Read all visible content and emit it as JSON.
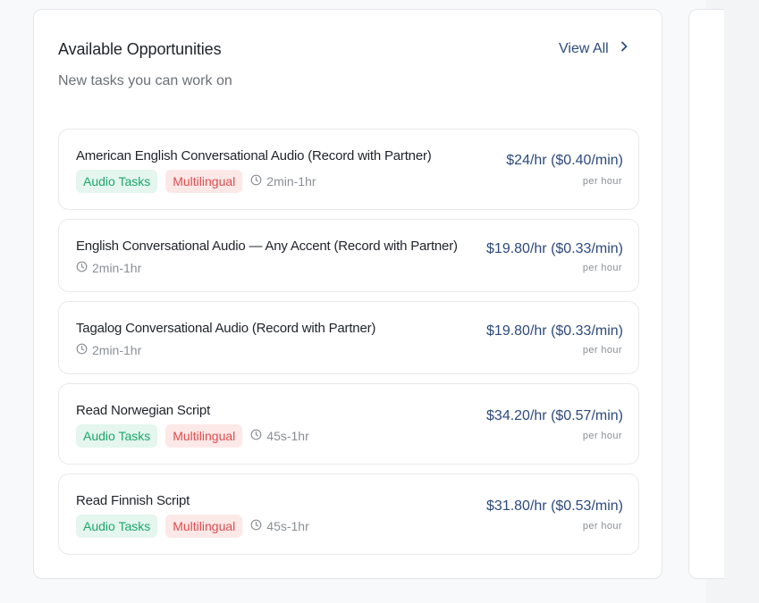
{
  "panel": {
    "title": "Available Opportunities",
    "subtitle": "New tasks you can work on",
    "view_all_label": "View All",
    "view_all_icon": "chevron-right-icon"
  },
  "tasks": [
    {
      "title": "American English Conversational Audio (Record with Partner)",
      "tags": [
        "Audio Tasks",
        "Multilingual"
      ],
      "duration": "2min-1hr",
      "rate": "$24/hr ($0.40/min)",
      "rate_unit": "per hour"
    },
    {
      "title": "English Conversational Audio — Any Accent (Record with Partner)",
      "tags": [],
      "duration": "2min-1hr",
      "rate": "$19.80/hr ($0.33/min)",
      "rate_unit": "per hour"
    },
    {
      "title": "Tagalog Conversational Audio (Record with Partner)",
      "tags": [],
      "duration": "2min-1hr",
      "rate": "$19.80/hr ($0.33/min)",
      "rate_unit": "per hour"
    },
    {
      "title": "Read Norwegian Script",
      "tags": [
        "Audio Tasks",
        "Multilingual"
      ],
      "duration": "45s-1hr",
      "rate": "$34.20/hr ($0.57/min)",
      "rate_unit": "per hour"
    },
    {
      "title": "Read Finnish Script",
      "tags": [
        "Audio Tasks",
        "Multilingual"
      ],
      "duration": "45s-1hr",
      "rate": "$31.80/hr ($0.53/min)",
      "rate_unit": "per hour"
    }
  ],
  "colors": {
    "accent": "#2d4a7c",
    "audio_tag_bg": "#e4f6ee",
    "audio_tag_text": "#1ea66a",
    "multilingual_tag_bg": "#fde8e8",
    "multilingual_tag_text": "#e04c4c",
    "muted_text": "#8a8f95"
  }
}
